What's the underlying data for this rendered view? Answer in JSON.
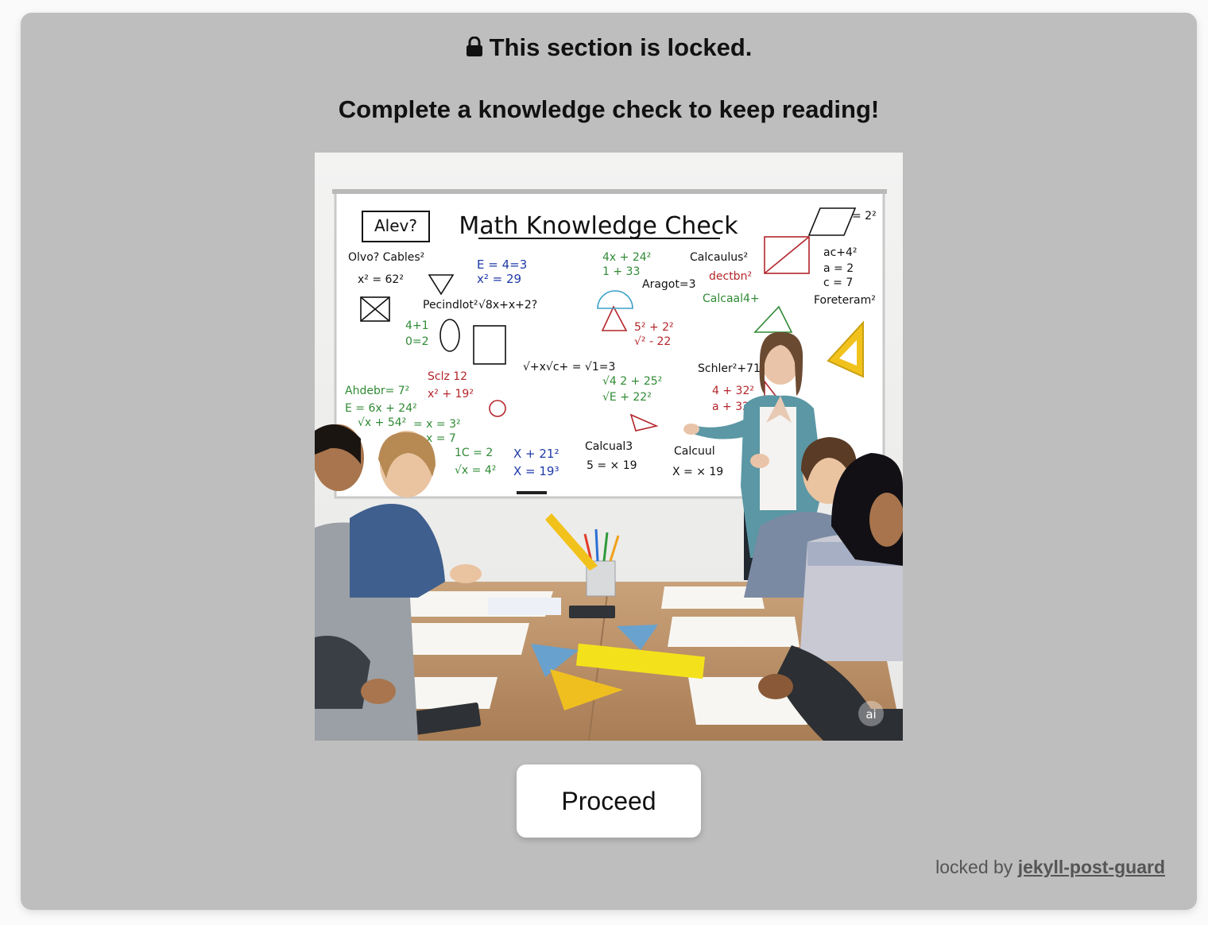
{
  "panel": {
    "title": "This section is locked.",
    "subtitle": "Complete a knowledge check to keep reading!",
    "lock_icon": "lock-icon"
  },
  "illustration": {
    "board_title": "Math Knowledge Check",
    "box_label": "Alev?",
    "corner_badge": "ai",
    "formulas_black": [
      "Olvo? Cables²",
      "x² = 62²",
      "Pecindlot²",
      "√8x+x+2?",
      "Calcaulus²",
      "ac+4²",
      "a = 2",
      "c = 7",
      "Foreteram²",
      "Schler²+71?",
      "Aragot=3",
      "√+x√c+ = √1=3",
      "Calcual3",
      "5 = × 19",
      "Calcuul",
      "X = × 19",
      "= 2²"
    ],
    "formulas_green": [
      "4+1",
      "0=2",
      "Ahdebr= 7²",
      "E = 6x + 24²",
      "√x + 54²",
      "1C = 2",
      "√x = 4²",
      "√4 2 + 25²",
      "√E + 22²",
      "Calcaal4+",
      "4x + 24²",
      "1 + 33",
      "= x = 3²",
      "x = 7"
    ],
    "formulas_red": [
      "Sclz 12",
      "x² + 19²",
      "5² + 2²",
      "√² - 22",
      "4 + 32²",
      "a + 32",
      "dectbn²"
    ],
    "formulas_blue": [
      "E = 4=3",
      "x² = 29",
      "X + 21²",
      "X = 19³"
    ]
  },
  "proceed_button": {
    "label": "Proceed"
  },
  "footer": {
    "prefix": "locked by",
    "link_text": "jekyll-post-guard"
  },
  "colors": {
    "panel_bg": "#bebebe",
    "page_bg": "#fafafa",
    "button_bg": "#ffffff"
  }
}
